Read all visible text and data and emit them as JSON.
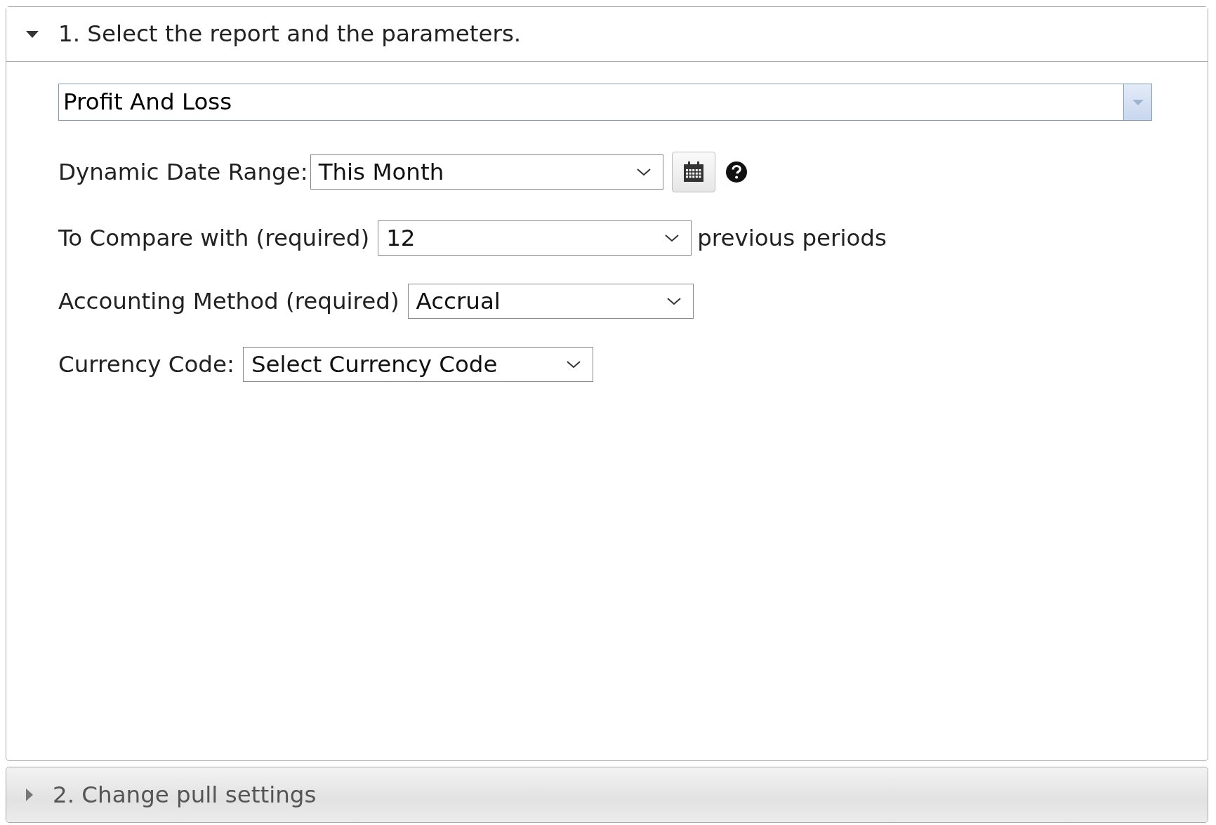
{
  "sections": [
    {
      "title": "1. Select the report and the parameters.",
      "expanded": true,
      "report": {
        "value": "Profit And Loss"
      },
      "fields": [
        {
          "kind": "date",
          "label": "Dynamic Date Range:",
          "value": "This Month"
        },
        {
          "kind": "select",
          "label": "To Compare with (required)",
          "value": "12",
          "suffix": "previous periods"
        },
        {
          "kind": "select",
          "label": "Accounting Method (required)",
          "value": "Accrual"
        },
        {
          "kind": "select",
          "label": "Currency Code:",
          "value": "Select Currency Code"
        }
      ]
    },
    {
      "title": "2. Change pull settings",
      "expanded": false
    }
  ]
}
